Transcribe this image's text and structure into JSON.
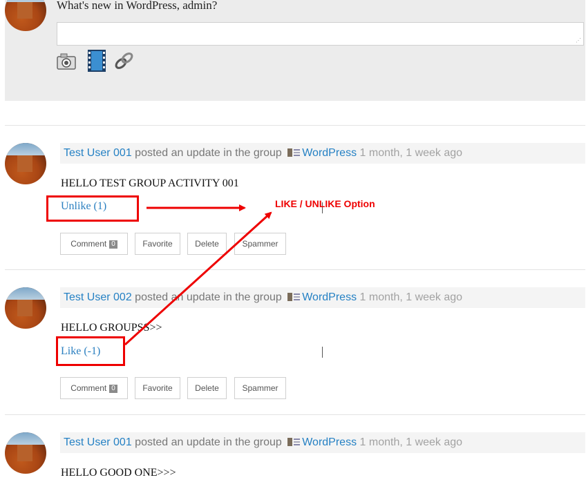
{
  "whats_new": {
    "title": "What's new in WordPress, admin?",
    "placeholder": "",
    "media_icons": [
      "camera-icon",
      "film-icon",
      "link-icon"
    ]
  },
  "activities": [
    {
      "user": "Test User 001",
      "action": " posted an update in the group ",
      "group": "WordPress",
      "time": " 1 month, 1 week ago",
      "content": "HELLO TEST GROUP ACTIVITY 001",
      "like_label": "Unlike (1)",
      "comment_label": "Comment",
      "comment_count": "0",
      "favorite_label": "Favorite",
      "delete_label": "Delete",
      "spammer_label": "Spammer"
    },
    {
      "user": "Test User 002",
      "action": " posted an update in the group ",
      "group": "WordPress",
      "time": " 1 month, 1 week ago",
      "content": "HELLO GROUPSS>>",
      "like_label": "Like (-1)",
      "comment_label": "Comment",
      "comment_count": "0",
      "favorite_label": "Favorite",
      "delete_label": "Delete",
      "spammer_label": "Spammer"
    },
    {
      "user": "Test User 001",
      "action": " posted an update in the group ",
      "group": "WordPress",
      "time": " 1 month, 1 week ago",
      "content": "HELLO GOOD ONE>>>"
    }
  ],
  "annotation": {
    "text": "LIKE / UNLIKE Option",
    "color": "#e00000"
  },
  "colors": {
    "link": "#2581c4",
    "timestamp": "#a2a2a2",
    "panel": "#ececec"
  }
}
